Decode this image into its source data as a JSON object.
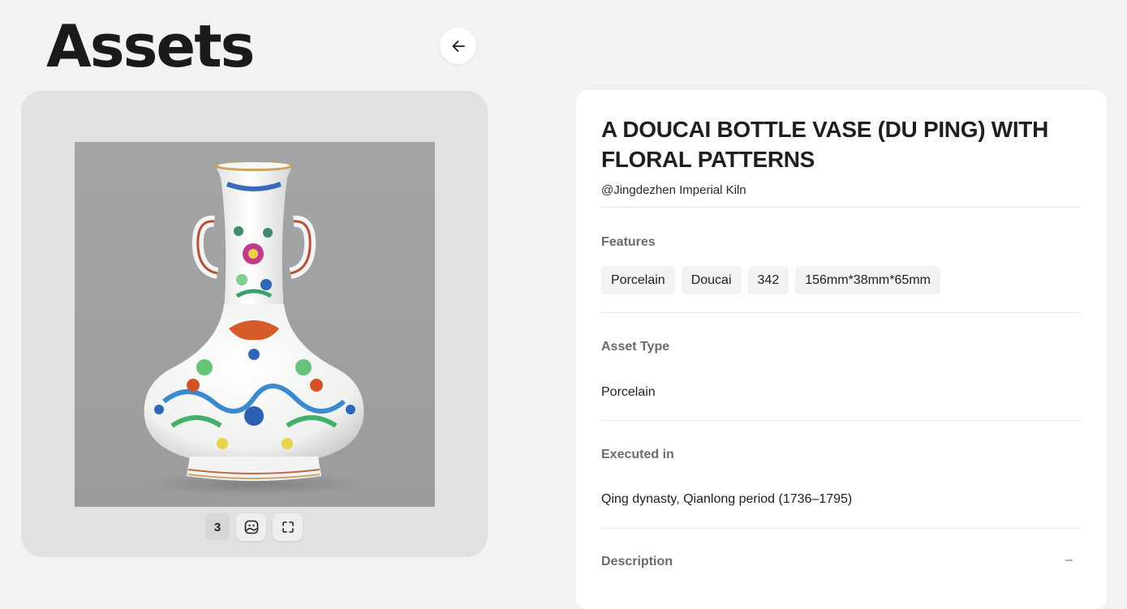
{
  "page": {
    "title": "Assets"
  },
  "gallery": {
    "image_count": "3",
    "controls": {
      "count_badge": "3",
      "view_icon": "image-face-icon",
      "fullscreen_icon": "fullscreen-icon"
    }
  },
  "asset": {
    "title": "A DOUCAI BOTTLE VASE (DU PING) WITH FLORAL PATTERNS",
    "artist": "@Jingdezhen Imperial Kiln",
    "features_label": "Features",
    "features": [
      "Porcelain",
      "Doucai",
      "342",
      "156mm*38mm*65mm"
    ],
    "asset_type_label": "Asset Type",
    "asset_type": "Porcelain",
    "executed_in_label": "Executed in",
    "executed_in": "Qing dynasty, Qianlong period (1736–1795)",
    "description_label": "Description",
    "description_toggle": "–"
  },
  "icons": {
    "back": "arrow-left-icon"
  }
}
